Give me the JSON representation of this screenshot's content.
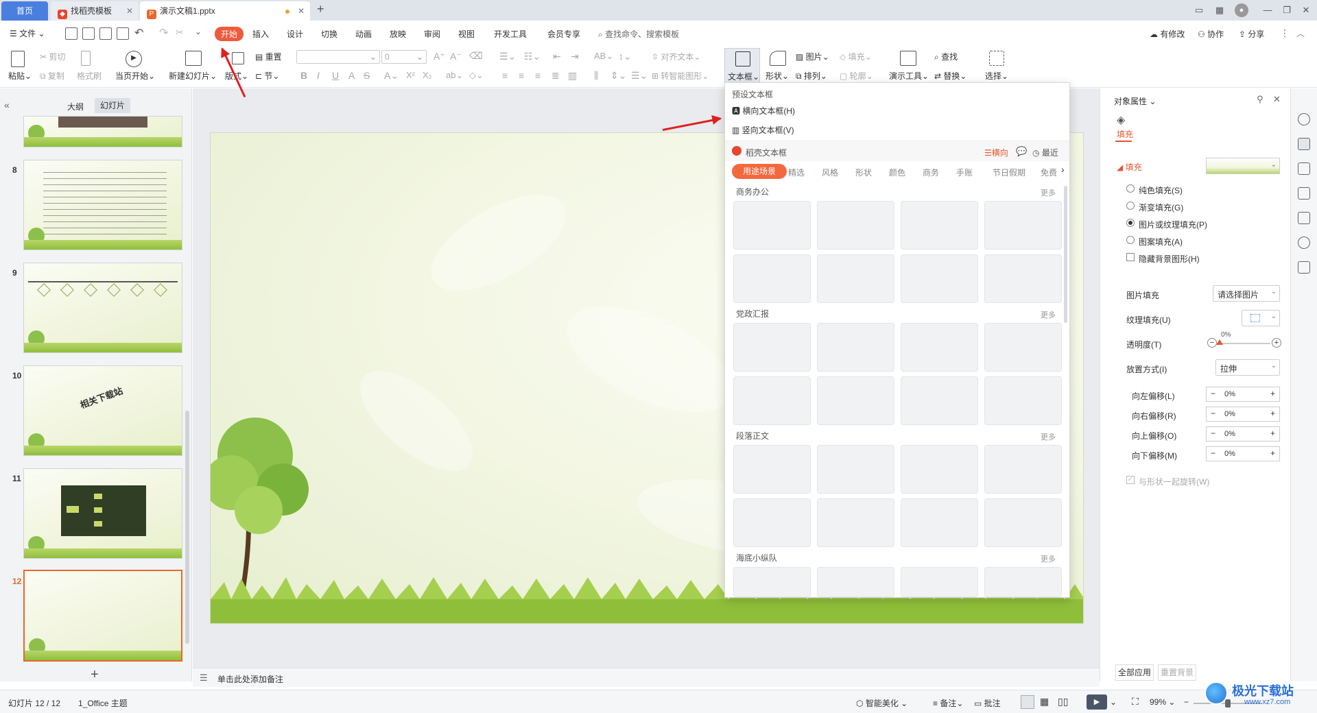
{
  "titlebar": {
    "tabs": [
      {
        "label": "首页"
      },
      {
        "label": "找稻壳模板"
      },
      {
        "label": "演示文稿1.pptx"
      }
    ],
    "new_tab": "+"
  },
  "menubar": {
    "file": "文件",
    "items": [
      "开始",
      "插入",
      "设计",
      "切换",
      "动画",
      "放映",
      "审阅",
      "视图",
      "开发工具",
      "会员专享"
    ],
    "search_placeholder": "查找命令、搜索模板",
    "right": {
      "modify": "有修改",
      "collab": "协作",
      "share": "分享"
    }
  },
  "ribbon": {
    "paste": "粘贴",
    "cut": "剪切",
    "copy": "复制",
    "format_painter": "格式刷",
    "from_start": "当页开始",
    "new_slide": "新建幻灯片",
    "layout": "版式",
    "reset": "重置",
    "section": "节",
    "font_size": "0",
    "align_text": "对齐文本",
    "convert_smartart": "转智能图形",
    "textbox": "文本框",
    "shape": "形状",
    "picture": "图片",
    "fill": "填充",
    "arrange": "排列",
    "outline": "轮廓",
    "present_tools": "演示工具",
    "find": "查找",
    "replace": "替换",
    "select": "选择"
  },
  "leftpanel": {
    "tabs": {
      "outline": "大纲",
      "slides": "幻灯片"
    },
    "slides": [
      {
        "num": "8"
      },
      {
        "num": "9"
      },
      {
        "num": "10",
        "text": "相关下载站"
      },
      {
        "num": "11"
      },
      {
        "num": "12"
      }
    ],
    "add": "+"
  },
  "dropdown": {
    "preset_title": "预设文本框",
    "horizontal": "横向文本框(H)",
    "vertical": "竖向文本框(V)",
    "docer_title": "稻壳文本框",
    "orientation": "横向",
    "recent": "最近",
    "categories": [
      "用途场景",
      "精选",
      "风格",
      "形状",
      "颜色",
      "商务",
      "手账",
      "节日假期",
      "免费"
    ],
    "sections": [
      {
        "title": "商务办公",
        "more": "更多"
      },
      {
        "title": "党政汇报",
        "more": "更多"
      },
      {
        "title": "段落正文",
        "more": "更多"
      },
      {
        "title": "海底小纵队",
        "more": "更多"
      }
    ]
  },
  "notes": {
    "placeholder": "单击此处添加备注"
  },
  "rightpanel": {
    "title": "对象属性",
    "fill_tab": "填充",
    "fill_section": "填充",
    "options": [
      {
        "label": "纯色填充(S)",
        "checked": false
      },
      {
        "label": "渐变填充(G)",
        "checked": false
      },
      {
        "label": "图片或纹理填充(P)",
        "checked": true
      },
      {
        "label": "图案填充(A)",
        "checked": false
      }
    ],
    "hide_bg": "隐藏背景图形(H)",
    "picture_fill_label": "图片填充",
    "picture_fill_value": "请选择图片",
    "texture_fill_label": "纹理填充(U)",
    "transparency_label": "透明度(T)",
    "transparency_value": "0%",
    "placement_label": "放置方式(I)",
    "placement_value": "拉伸",
    "offsets": [
      {
        "label": "向左偏移(L)",
        "value": "0%"
      },
      {
        "label": "向右偏移(R)",
        "value": "0%"
      },
      {
        "label": "向上偏移(O)",
        "value": "0%"
      },
      {
        "label": "向下偏移(M)",
        "value": "0%"
      }
    ],
    "rotate_with_shape": "与形状一起旋转(W)",
    "apply_all": "全部应用",
    "reset_bg": "重置背景"
  },
  "status": {
    "slide_pos": "幻灯片 12 / 12",
    "theme": "1_Office 主题",
    "smart": "智能美化",
    "notes": "备注",
    "comment": "批注",
    "zoom": "99%"
  },
  "watermark": {
    "text": "极光下载站",
    "url": "www.xz7.com"
  },
  "colors": {
    "accent": "#f05a3c",
    "home_tab": "#4a7fe0",
    "arrow": "#e02020"
  }
}
